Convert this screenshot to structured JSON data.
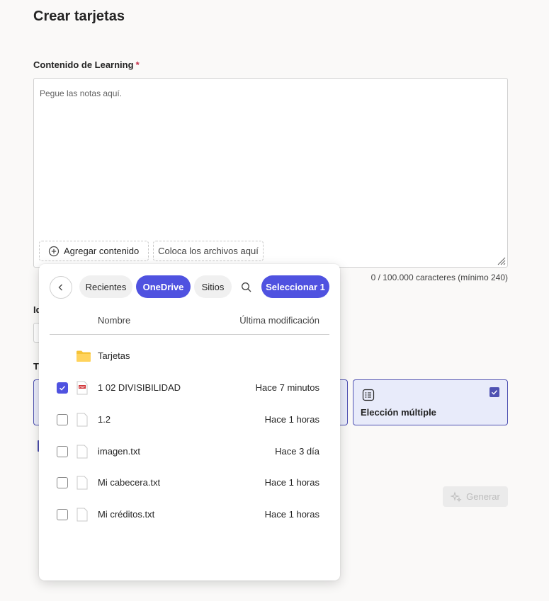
{
  "page": {
    "title": "Crear tarjetas",
    "content_label": "Contenido de Learning",
    "required_mark": "*",
    "notes_placeholder": "Pegue las notas aquí.",
    "add_content_label": "Agregar contenido",
    "drop_zone_label": "Coloca los archivos aquí",
    "char_count": "0 / 100.000 caracteres (mínimo 240)",
    "fragment_label_1": "Id",
    "fragment_label_2": "Ti",
    "multiple_choice_label": "Elección múltiple",
    "generate_label": "Generar"
  },
  "picker": {
    "tabs": [
      {
        "label": "Recientes",
        "active": false
      },
      {
        "label": "OneDrive",
        "active": true
      },
      {
        "label": "Sitios",
        "active": false
      }
    ],
    "select_button": "Seleccionar 1",
    "columns": {
      "name": "Nombre",
      "modified": "Última modificación"
    },
    "items": [
      {
        "type": "folder",
        "name": "Tarjetas",
        "modified": "",
        "checked": false
      },
      {
        "type": "pdf",
        "name": "1 02 DIVISIBILIDAD",
        "modified": "Hace 7 minutos",
        "checked": true
      },
      {
        "type": "file",
        "name": "1.2",
        "modified": "Hace 1 horas",
        "checked": false
      },
      {
        "type": "file",
        "name": "imagen.txt",
        "modified": "Hace 3 día",
        "checked": false
      },
      {
        "type": "file",
        "name": "Mi cabecera.txt",
        "modified": "Hace 1 horas",
        "checked": false
      },
      {
        "type": "file",
        "name": "Mi créditos.txt",
        "modified": "Hace 1 horas",
        "checked": false
      }
    ]
  },
  "colors": {
    "accent": "#4f52e0",
    "card_border": "#4f52b2",
    "card_bg": "#e8ebfa",
    "required": "#c4314b"
  },
  "icons": {
    "back": "chevron-left-icon",
    "search": "search-icon",
    "add": "add-circle-icon",
    "generate": "sparkle-icon",
    "multiple_choice": "list-icon",
    "folder": "folder-icon",
    "pdf": "pdf-file-icon",
    "file": "document-icon"
  }
}
